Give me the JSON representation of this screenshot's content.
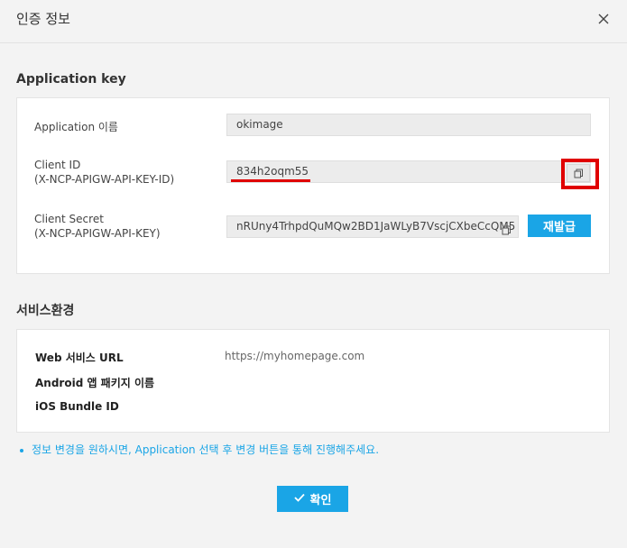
{
  "dialog": {
    "title": "인증 정보"
  },
  "application_key": {
    "section_title": "Application key",
    "app_name_label": "Application 이름",
    "app_name_value": "okimage",
    "client_id_label_1": "Client ID",
    "client_id_label_2": "(X-NCP-APIGW-API-KEY-ID)",
    "client_id_value": "834h2oqm55",
    "client_secret_label_1": "Client Secret",
    "client_secret_label_2": "(X-NCP-APIGW-API-KEY)",
    "client_secret_value": "nRUny4TrhpdQuMQw2BD1JaWLyB7VscjCXbeCcQM5",
    "reissue_label": "재발급"
  },
  "service_env": {
    "section_title": "서비스환경",
    "web_url_label": "Web 서비스 URL",
    "web_url_value": "https://myhomepage.com",
    "android_label": "Android 앱 패키지 이름",
    "ios_label": "iOS Bundle ID"
  },
  "notice": "정보 변경을 원하시면, Application 선택 후 변경 버튼을 통해 진행해주세요.",
  "confirm_label": "확인",
  "colors": {
    "accent": "#1aa5e6",
    "highlight_red": "#e00000",
    "background": "#f3f3f3"
  },
  "icons": [
    "close-icon",
    "copy-icon",
    "check-icon"
  ]
}
